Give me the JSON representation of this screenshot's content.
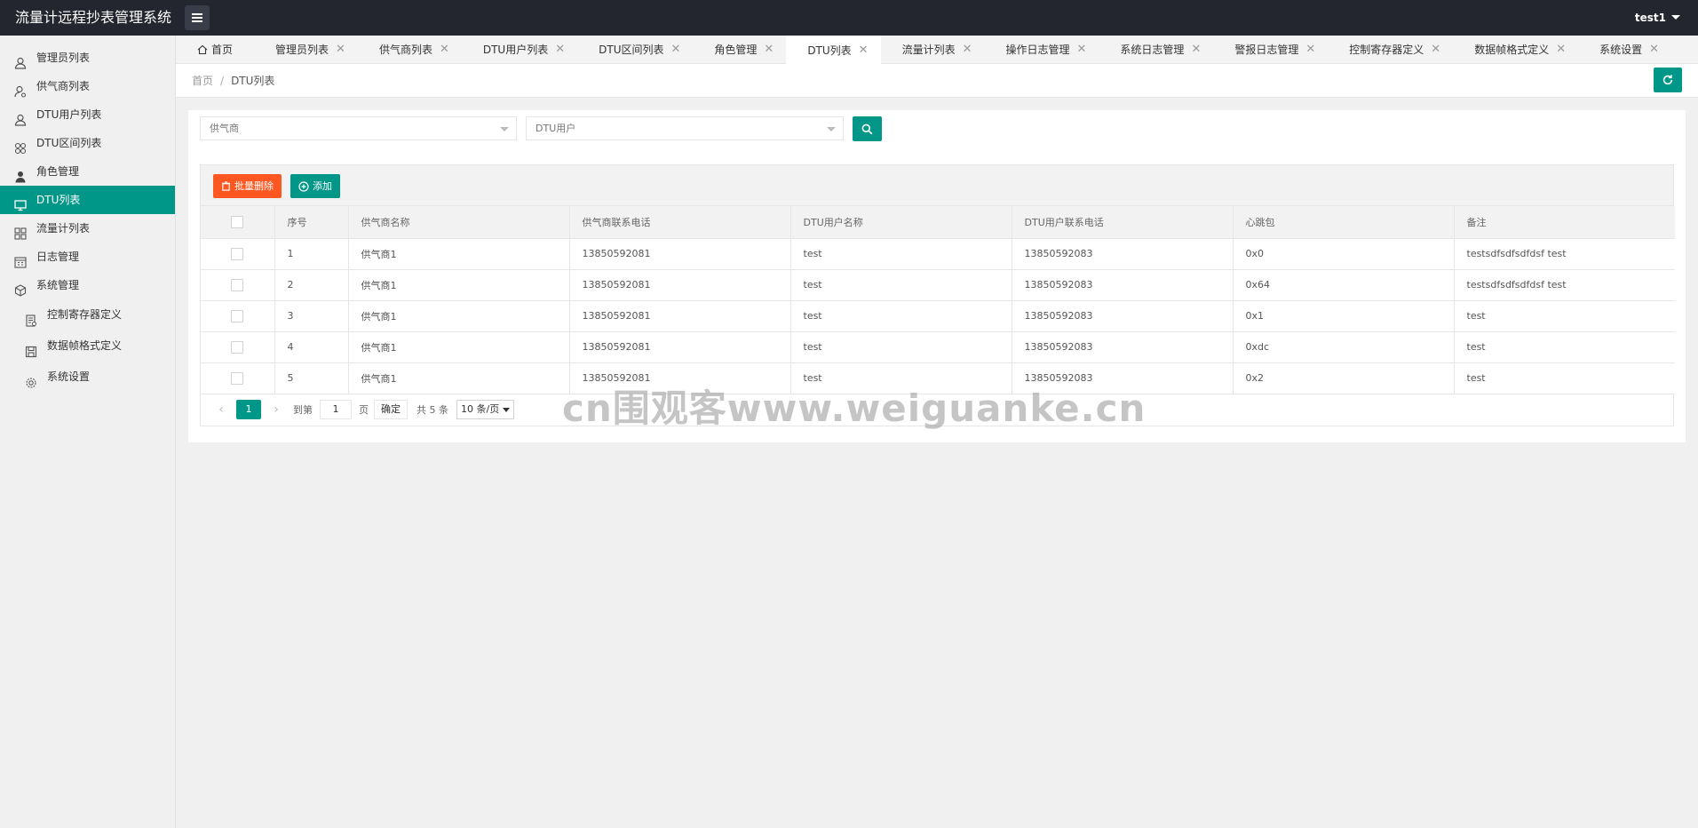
{
  "header": {
    "title": "流量计远程抄表管理系统",
    "user": "test1"
  },
  "sidebar": {
    "items": [
      {
        "label": "管理员列表",
        "icon": "user-icon"
      },
      {
        "label": "供气商列表",
        "icon": "user-cog-icon"
      },
      {
        "label": "DTU用户列表",
        "icon": "user-icon"
      },
      {
        "label": "DTU区间列表",
        "icon": "grid-icon"
      },
      {
        "label": "角色管理",
        "icon": "person-filled-icon"
      },
      {
        "label": "DTU列表",
        "icon": "monitor-icon",
        "active": true
      },
      {
        "label": "流量计列表",
        "icon": "apps-icon"
      },
      {
        "label": "日志管理",
        "icon": "calendar-icon"
      },
      {
        "label": "系统管理",
        "icon": "cube-icon"
      },
      {
        "label": "控制寄存器定义",
        "icon": "doc-icon",
        "sub": true
      },
      {
        "label": "数据帧格式定义",
        "icon": "save-icon",
        "sub": true
      },
      {
        "label": "系统设置",
        "icon": "gear-icon",
        "sub": true
      }
    ]
  },
  "tabs": [
    {
      "label": "首页",
      "home": true
    },
    {
      "label": "管理员列表"
    },
    {
      "label": "供气商列表"
    },
    {
      "label": "DTU用户列表"
    },
    {
      "label": "DTU区间列表"
    },
    {
      "label": "角色管理"
    },
    {
      "label": "DTU列表",
      "active": true
    },
    {
      "label": "流量计列表"
    },
    {
      "label": "操作日志管理"
    },
    {
      "label": "系统日志管理"
    },
    {
      "label": "警报日志管理"
    },
    {
      "label": "控制寄存器定义"
    },
    {
      "label": "数据帧格式定义"
    },
    {
      "label": "系统设置"
    }
  ],
  "tab_close_glyph": "✕",
  "breadcrumb": {
    "home": "首页",
    "separator": "/",
    "current": "DTU列表"
  },
  "filters": {
    "supplier_placeholder": "供气商",
    "dtu_user_placeholder": "DTU用户"
  },
  "toolbar": {
    "batch_delete": "批量删除",
    "add": "添加"
  },
  "table": {
    "columns": [
      "序号",
      "供气商名称",
      "供气商联系电话",
      "DTU用户名称",
      "DTU用户联系电话",
      "心跳包",
      "备注"
    ],
    "rows": [
      [
        "1",
        "供气商1",
        "13850592081",
        "test",
        "13850592083",
        "0x0",
        "testsdfsdfsdfdsf test"
      ],
      [
        "2",
        "供气商1",
        "13850592081",
        "test",
        "13850592083",
        "0x64",
        "testsdfsdfsdfdsf test"
      ],
      [
        "3",
        "供气商1",
        "13850592081",
        "test",
        "13850592083",
        "0x1",
        "test"
      ],
      [
        "4",
        "供气商1",
        "13850592081",
        "test",
        "13850592083",
        "0xdc",
        "test"
      ],
      [
        "5",
        "供气商1",
        "13850592081",
        "test",
        "13850592083",
        "0x2",
        "test"
      ]
    ]
  },
  "pagination": {
    "prev": "‹",
    "current": "1",
    "next": "›",
    "goto_label": "到第",
    "goto_value": "1",
    "page_unit": "页",
    "confirm": "确定",
    "total": "共 5 条",
    "per_page": "10 条/页"
  },
  "watermark": "cn围观客www.weiguanke.cn",
  "colors": {
    "header_bg": "#23262e",
    "accent": "#009688",
    "danger": "#ff5722"
  }
}
